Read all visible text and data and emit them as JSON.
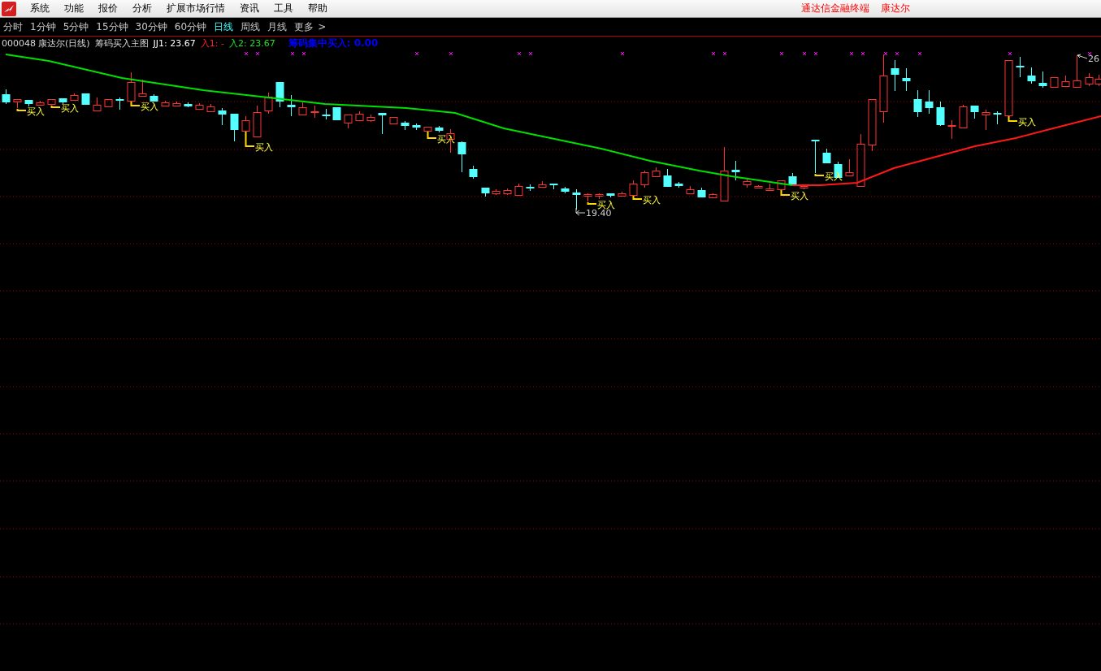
{
  "menu": {
    "items": [
      "系统",
      "功能",
      "报价",
      "分析",
      "扩展市场行情",
      "资讯",
      "工具",
      "帮助"
    ],
    "product": "通达信金融终端",
    "stock": "康达尔"
  },
  "periods": [
    {
      "label": "分时",
      "selected": false
    },
    {
      "label": "1分钟",
      "selected": false
    },
    {
      "label": "5分钟",
      "selected": false
    },
    {
      "label": "15分钟",
      "selected": false
    },
    {
      "label": "30分钟",
      "selected": false
    },
    {
      "label": "60分钟",
      "selected": false
    },
    {
      "label": "日线",
      "selected": true
    },
    {
      "label": "周线",
      "selected": false
    },
    {
      "label": "月线",
      "selected": false
    }
  ],
  "more": {
    "label": "更多",
    "arrow": ">"
  },
  "chart": {
    "code": "000048",
    "name": "康达尔(日线)",
    "indicator": "筹码买入主图",
    "values": [
      {
        "label": "JJ1: 23.67",
        "color": "#ffffff"
      },
      {
        "label": "入1: -",
        "color": "#ff2020"
      },
      {
        "label": "入2: 23.67",
        "color": "#20e020"
      },
      {
        "label": "筹码集中买入: 0.00",
        "color": "#0000ff"
      }
    ],
    "buy_labels": [
      "买入",
      "买入",
      "买入",
      "买入",
      "买入",
      "买入",
      "买入",
      "买入",
      "买入",
      "买入"
    ],
    "low_label": "19.40",
    "high_label": "26"
  }
}
